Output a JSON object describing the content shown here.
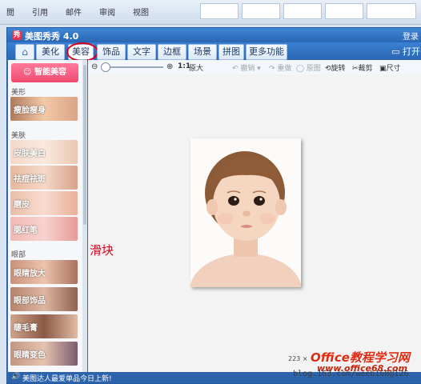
{
  "word_ribbon": {
    "menu": [
      "閲",
      "引用",
      "邮件",
      "审阅",
      "视图"
    ]
  },
  "app": {
    "title": "美图秀秀 4.0",
    "title_right": "登录",
    "logo_char": "秀"
  },
  "tabs": {
    "home_icon": "⌂",
    "items": [
      "美化",
      "美容",
      "饰品",
      "文字",
      "边框",
      "场景",
      "拼图",
      "更多功能 ▾"
    ],
    "active": "美容",
    "open_label": "打开"
  },
  "left_panel": {
    "smart_button": "智能美容",
    "sections": [
      {
        "label": "美形",
        "items": [
          "瘦脸瘦身"
        ]
      },
      {
        "label": "美肤",
        "items": [
          "皮肤美白",
          "祛痘祛斑",
          "磨皮",
          "腮红笔"
        ]
      },
      {
        "label": "眼部",
        "items": [
          "眼睛放大",
          "眼部饰品",
          "睫毛膏",
          "眼睛变色"
        ]
      }
    ]
  },
  "toolbar": {
    "zoom_out_icon": "⊖",
    "zoom_in_icon": "⊕",
    "ratio": "1:1",
    "original_size": "原大",
    "undo": "↶ 撤销 ▾",
    "redo": "↷ 重做",
    "original_image": "◯ 原图",
    "rotate": "旋转",
    "crop": "裁剪",
    "size": "尺寸",
    "zoom_level": 0.0
  },
  "canvas": {
    "annotation": "滑块",
    "size_readout": "223 ×"
  },
  "statusbar": {
    "icon": "🔊",
    "text": "美图达人最爱单品今日上新!"
  },
  "watermarks": {
    "blog": "blog.163.com/weeb168@126",
    "office": "Office教程学习网",
    "url": "www.office68.com"
  },
  "colors": {
    "accent_blue": "#2f6fc0",
    "smart_pink": "#f04a72",
    "annotation_red": "#e0001b"
  }
}
